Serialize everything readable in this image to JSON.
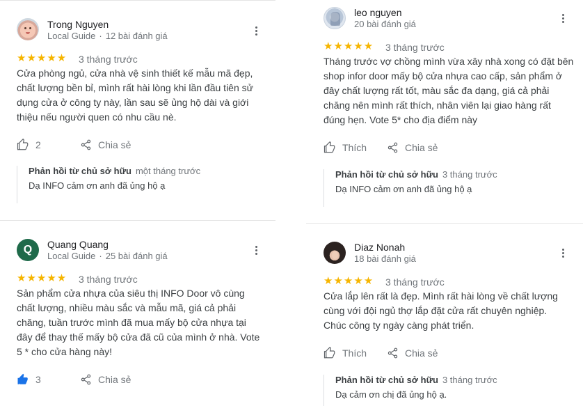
{
  "reviews": [
    {
      "name": "Trong Nguyen",
      "badge": "Local Guide",
      "count": "12 bài đánh giá",
      "stars": "★★★★★",
      "rating": 5,
      "time": "3 tháng trước",
      "text": "Cửa phòng ngủ, cửa nhà vệ sinh thiết kế mẫu mã đẹp, chất lượng bền bỉ, mình rất hài lòng khi lần đầu tiên sử dụng cửa ở công ty này, lần sau sẽ ủng hộ dài và giới thiệu nếu người quen có nhu cầu nè.",
      "likes": "2",
      "share": "Chia sẻ",
      "reply_owner": "Phản hồi từ chủ sở hữu",
      "reply_time": "một tháng trước",
      "reply_text": "Dạ INFO cảm ơn anh đã ủng hộ ạ"
    },
    {
      "name": "leo nguyen",
      "count": "20 bài đánh giá",
      "stars": "★★★★★",
      "rating": 5,
      "time": "3 tháng trước",
      "text": "Tháng trước vợ chồng mình vừa xây nhà xong có đặt bên shop infor door mấy bộ cửa nhựa cao cấp, sản phẩm ở đây chất lượng rất tốt, màu sắc đa dạng, giá cả phải chăng nên mình rất thích, nhân viên lại giao hàng rất đúng hẹn. Vote 5* cho địa điểm này",
      "like_label": "Thích",
      "share": "Chia sẻ",
      "reply_owner": "Phản hồi từ chủ sở hữu",
      "reply_time": "3 tháng trước",
      "reply_text": "Dạ INFO cảm ơn anh đã ủng hộ ạ"
    },
    {
      "name": "Quang Quang",
      "avatar_letter": "Q",
      "badge": "Local Guide",
      "count": "25 bài đánh giá",
      "stars": "★★★★★",
      "rating": 5,
      "time": "3 tháng trước",
      "text": "Sản phẩm cửa nhựa của siêu thị INFO Door vô cùng chất lượng, nhiều màu sắc và mẫu mã, giá cả phải chăng, tuần trước mình đã mua mấy bộ cửa nhựa tại đây để thay thế mấy bộ cửa đã cũ của mình ở nhà. Vote 5 * cho cửa hàng này!",
      "likes": "3",
      "share": "Chia sẻ"
    },
    {
      "name": "Diaz Nonah",
      "count": "18 bài đánh giá",
      "stars": "★★★★★",
      "rating": 5,
      "time": "3 tháng trước",
      "text": "Cửa lắp lên rất là đẹp. Mình rất hài lòng về chất lượng cùng với đội ngủ thợ lắp đặt cửa rất chuyên nghiệp. Chúc công ty ngày càng phát triển.",
      "like_label": "Thích",
      "share": "Chia sẻ",
      "reply_owner": "Phản hồi từ chủ sở hữu",
      "reply_time": "3 tháng trước",
      "reply_text": "Dạ cảm ơn chị đã ủng hộ ạ."
    }
  ],
  "colors": {
    "star": "#f6b500",
    "liked": "#1a73e8",
    "avatar_q": "#1f6a4a"
  },
  "icons": [
    "thumb-up-icon",
    "share-icon",
    "more-vert-icon"
  ]
}
